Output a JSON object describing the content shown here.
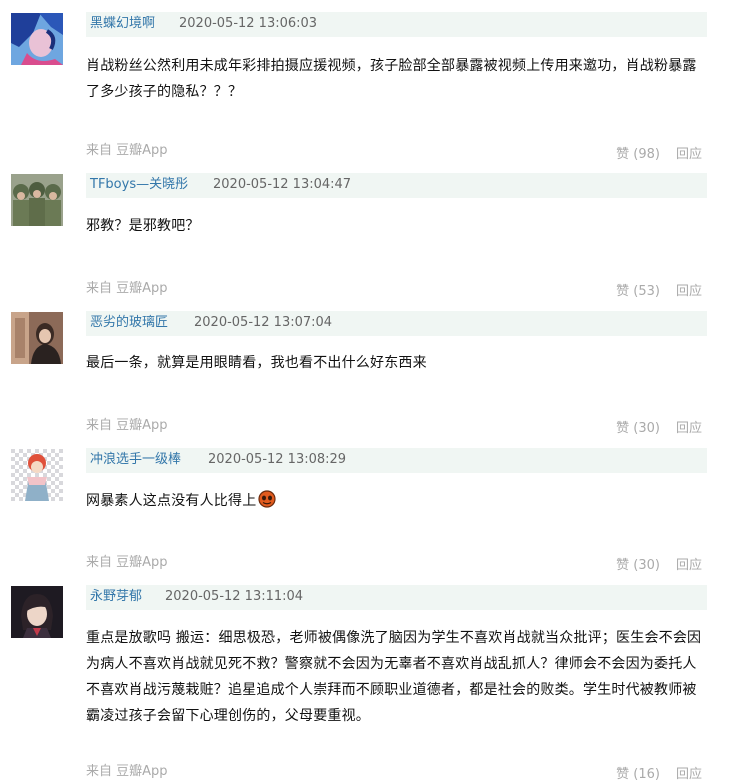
{
  "comments": [
    {
      "user": "黑蝶幻境啊",
      "time": "2020-05-12 13:06:03",
      "text": "肖战粉丝公然利用未成年彩排拍摄应援视频，孩子脸部全部暴露被视频上传用来邀功，肖战粉暴露了多少孩子的隐私？？？",
      "source": "来自 豆瓣App",
      "likes": "赞 (98)",
      "reply": "回应"
    },
    {
      "user": "TFboys—关晓彤",
      "time": "2020-05-12 13:04:47",
      "text": "邪教？是邪教吧？",
      "source": "来自 豆瓣App",
      "likes": "赞 (53)",
      "reply": "回应"
    },
    {
      "user": "恶劣的玻璃匠",
      "time": "2020-05-12 13:07:04",
      "text": "最后一条，就算是用眼睛看，我也看不出什么好东西来",
      "source": "来自 豆瓣App",
      "likes": "赞 (30)",
      "reply": "回应"
    },
    {
      "user": "冲浪选手一级棒",
      "time": "2020-05-12 13:08:29",
      "text": "网暴素人这点没有人比得上",
      "source": "来自 豆瓣App",
      "likes": "赞 (30)",
      "reply": "回应"
    },
    {
      "user": "永野芽郁",
      "time": "2020-05-12 13:11:04",
      "text": "重点是放歌吗 搬运：细思极恐，老师被偶像洗了脑因为学生不喜欢肖战就当众批评；医生会不会因为病人不喜欢肖战就见死不救？警察就不会因为无辜者不喜欢肖战乱抓人？律师会不会因为委托人不喜欢肖战污蔑栽赃？追星追成个人崇拜而不顾职业道德者，都是社会的败类。学生时代被教师被霸凌过孩子会留下心理创伤的，父母要重视。",
      "source": "来自 豆瓣App",
      "likes": "赞 (16)",
      "reply": "回应"
    }
  ]
}
